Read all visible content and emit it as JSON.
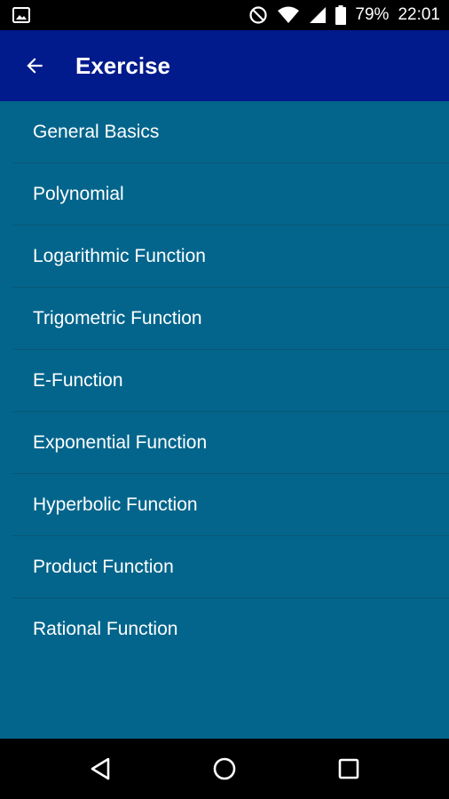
{
  "status_bar": {
    "battery": "79%",
    "time": "22:01",
    "icons": [
      "gallery-icon",
      "do-not-disturb-icon",
      "wifi-icon",
      "cell-signal-icon",
      "battery-icon"
    ]
  },
  "app_bar": {
    "title": "Exercise",
    "back_icon": "back-arrow-icon"
  },
  "list": {
    "items": [
      {
        "label": "General Basics"
      },
      {
        "label": "Polynomial"
      },
      {
        "label": "Logarithmic Function"
      },
      {
        "label": "Trigometric Function"
      },
      {
        "label": "E-Function"
      },
      {
        "label": "Exponential Function"
      },
      {
        "label": "Hyperbolic Function"
      },
      {
        "label": "Product Function"
      },
      {
        "label": "Rational Function"
      }
    ]
  },
  "nav_bar": {
    "icons": [
      "back-triangle-icon",
      "home-circle-icon",
      "recents-square-icon"
    ]
  },
  "colors": {
    "app_bar": "#011a8c",
    "list_bg": "#03658c",
    "divider": "#0a5676",
    "text": "#ffffff"
  }
}
